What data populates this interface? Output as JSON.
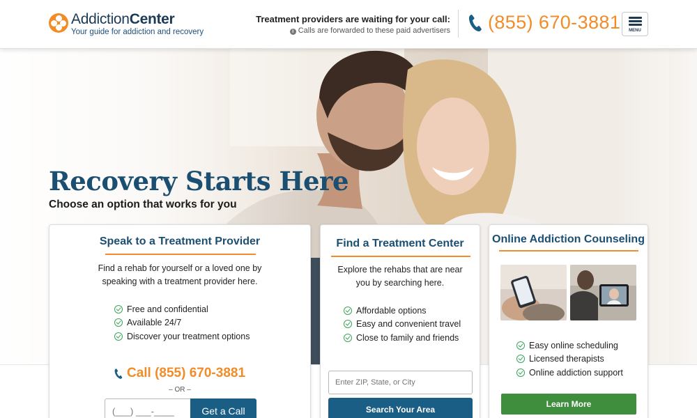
{
  "header": {
    "logo_title_part1": "Addiction",
    "logo_title_part2": "Center",
    "logo_tagline": "Your guide for addiction and recovery",
    "callout_main": "Treatment providers are waiting for your call:",
    "callout_sub": "Calls are forwarded to these paid advertisers",
    "phone": "(855) 670-3881",
    "menu_label": "MENU"
  },
  "hero": {
    "title": "Recovery Starts Here",
    "subtitle": "Choose an option that works for you"
  },
  "cards": {
    "speak": {
      "title": "Speak to a Treatment Provider",
      "description": "Find a rehab for yourself or a loved one by speaking with a treatment provider here.",
      "features": [
        "Free and confidential",
        "Available 24/7",
        "Discover your treatment options"
      ],
      "call_label": "Call (855) 670-3881",
      "or_text": "– OR –",
      "callback_placeholder": "(___) ___-____",
      "callback_button": "Get a Call"
    },
    "find": {
      "title": "Find a Treatment Center",
      "description": "Explore the rehabs that are near you by searching here.",
      "features": [
        "Affordable options",
        "Easy and convenient travel",
        "Close to family and friends"
      ],
      "search_placeholder": "Enter ZIP, State, or City",
      "search_button": "Search Your Area"
    },
    "online": {
      "title": "Online Addiction Counseling",
      "features": [
        "Easy online scheduling",
        "Licensed therapists",
        "Online addiction support"
      ],
      "button": "Learn More"
    }
  },
  "colors": {
    "brand_orange": "#f28c28",
    "brand_blue": "#1b4f72",
    "button_blue": "#1b5e85",
    "button_green": "#3e8e3e",
    "check_green": "#3aa35a"
  }
}
